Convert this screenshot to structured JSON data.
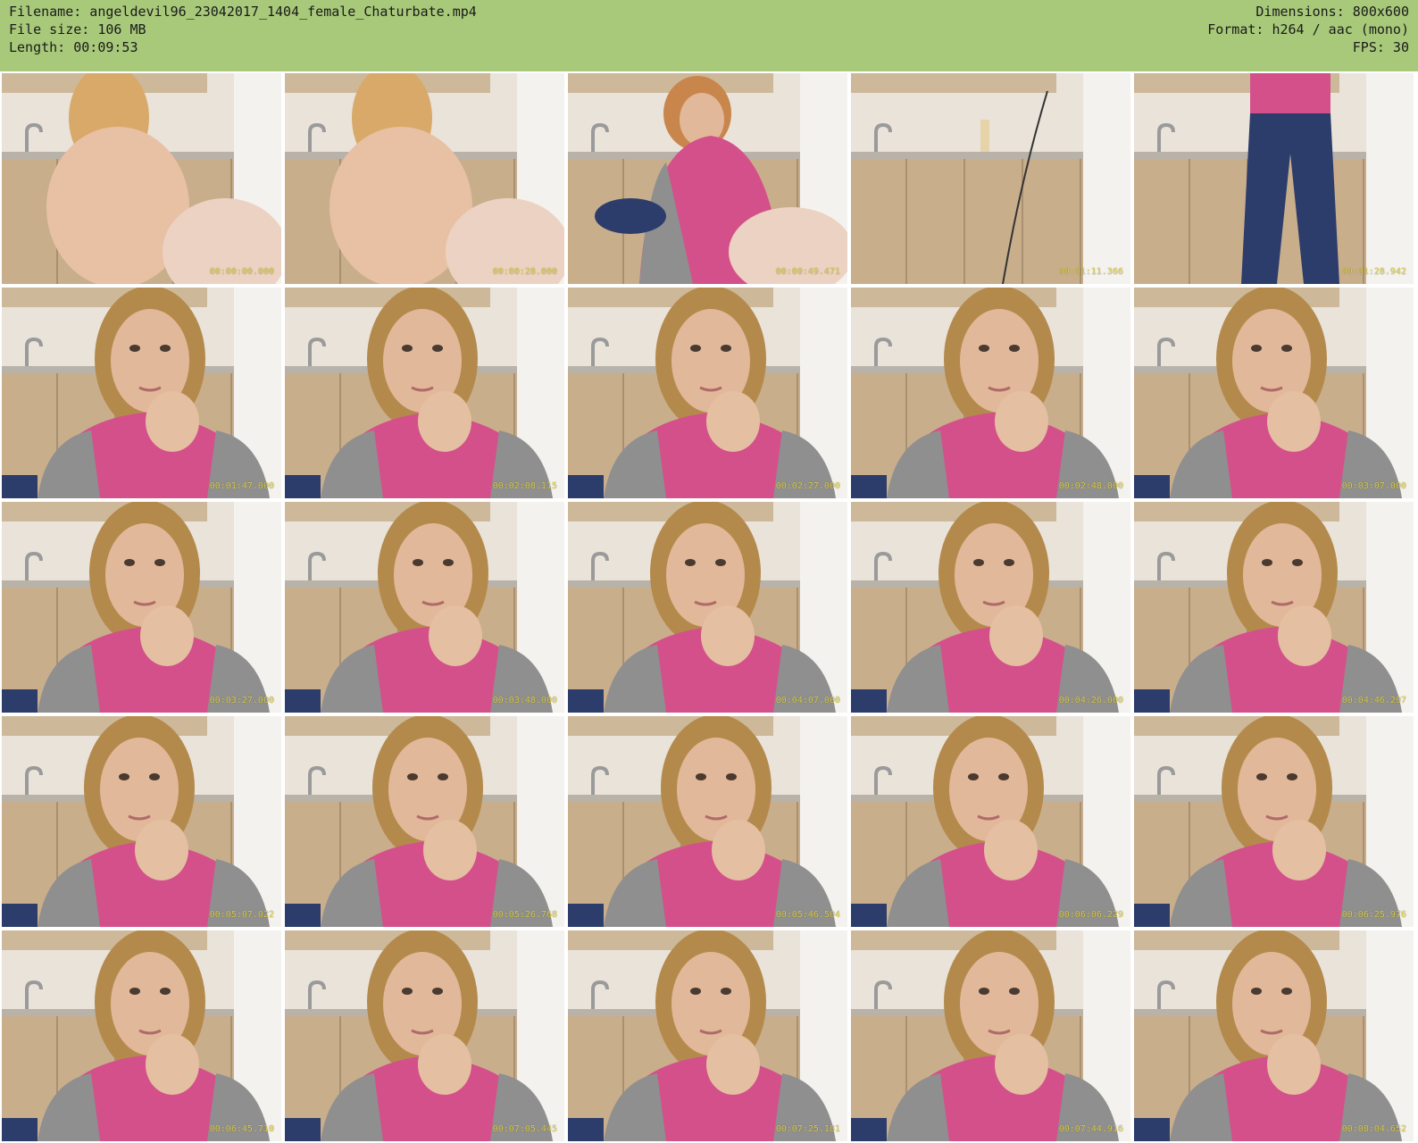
{
  "header": {
    "background": "#a8c97a",
    "left": [
      "Filename: angeldevil96_23042017_1404_female_Chaturbate.mp4",
      "File size: 106 MB",
      "Length: 00:09:53"
    ],
    "right": [
      "Dimensions: 800x600",
      "Format: h264 / aac (mono)",
      "FPS: 30"
    ]
  },
  "thumbnails": [
    {
      "timestamp": "00:00:00.000",
      "scene": "unclothed"
    },
    {
      "timestamp": "00:00:28.000",
      "scene": "unclothed"
    },
    {
      "timestamp": "00:00:49.471",
      "scene": "dressing"
    },
    {
      "timestamp": "00:01:11.366",
      "scene": "empty"
    },
    {
      "timestamp": "00:01:28.942",
      "scene": "standing"
    },
    {
      "timestamp": "00:01:47.000",
      "scene": "face"
    },
    {
      "timestamp": "00:02:08.115",
      "scene": "face"
    },
    {
      "timestamp": "00:02:27.000",
      "scene": "face"
    },
    {
      "timestamp": "00:02:48.000",
      "scene": "face"
    },
    {
      "timestamp": "00:03:07.000",
      "scene": "face"
    },
    {
      "timestamp": "00:03:27.000",
      "scene": "face"
    },
    {
      "timestamp": "00:03:48.000",
      "scene": "face"
    },
    {
      "timestamp": "00:04:07.000",
      "scene": "face"
    },
    {
      "timestamp": "00:04:26.000",
      "scene": "face"
    },
    {
      "timestamp": "00:04:46.297",
      "scene": "face"
    },
    {
      "timestamp": "00:05:07.022",
      "scene": "face"
    },
    {
      "timestamp": "00:05:26.768",
      "scene": "face"
    },
    {
      "timestamp": "00:05:46.504",
      "scene": "face"
    },
    {
      "timestamp": "00:06:06.229",
      "scene": "face"
    },
    {
      "timestamp": "00:06:25.976",
      "scene": "face"
    },
    {
      "timestamp": "00:06:45.710",
      "scene": "face"
    },
    {
      "timestamp": "00:07:05.445",
      "scene": "face"
    },
    {
      "timestamp": "00:07:25.181",
      "scene": "face"
    },
    {
      "timestamp": "00:07:44.916",
      "scene": "face"
    },
    {
      "timestamp": "00:08:04.652",
      "scene": "face"
    }
  ]
}
